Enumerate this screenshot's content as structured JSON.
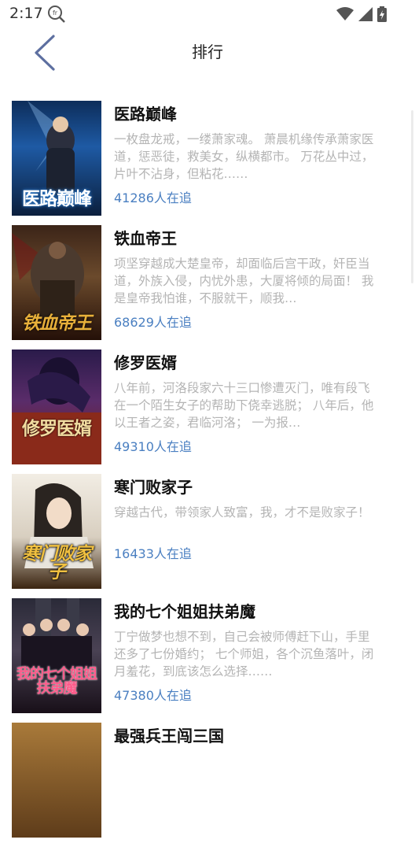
{
  "status_bar": {
    "time": "2:17",
    "notification_icon": "font-search-icon",
    "icons": [
      "wifi-icon",
      "signal-icon",
      "battery-charging-icon"
    ]
  },
  "header": {
    "back_icon": "chevron-left-icon",
    "title": "排行"
  },
  "books": [
    {
      "title": "医路巅峰",
      "description": "一枚盘龙戒，一缕萧家魂。 萧晨机缘传承萧家医道，惩恶徒，救美女，纵横都市。 万花丛中过，片叶不沾身，但粘花……",
      "followers": "41286人在追",
      "cover_text": "医路巅峰"
    },
    {
      "title": "铁血帝王",
      "description": "项坚穿越成大楚皇帝，却面临后宫干政，奸臣当道，外族入侵，内忧外患，大厦将倾的局面！ 我是皇帝我怕谁，不服就干，顺我…",
      "followers": "68629人在追",
      "cover_text": "铁血帝王"
    },
    {
      "title": "修罗医婿",
      "description": "八年前，河洛段家六十三口惨遭灭门，唯有段飞在一个陌生女子的帮助下侥幸逃脱； 八年后，他以王者之姿，君临河洛； 一为报…",
      "followers": "49310人在追",
      "cover_text": "修罗医婿"
    },
    {
      "title": "寒门败家子",
      "description": "穿越古代，带领家人致富，我，才不是败家子！",
      "followers": "16433人在追",
      "cover_text": "寒门败家子"
    },
    {
      "title": "我的七个姐姐扶弟魔",
      "description": "丁宁做梦也想不到，自己会被师傅赶下山，手里还多了七份婚约； 七个师姐，各个沉鱼落叶，闭月羞花，到底该怎么选择……",
      "followers": "47380人在追",
      "cover_text": "我的七个姐姐扶弟魔"
    },
    {
      "title": "最强兵王闯三国",
      "description": "",
      "followers": "",
      "cover_text": ""
    }
  ]
}
